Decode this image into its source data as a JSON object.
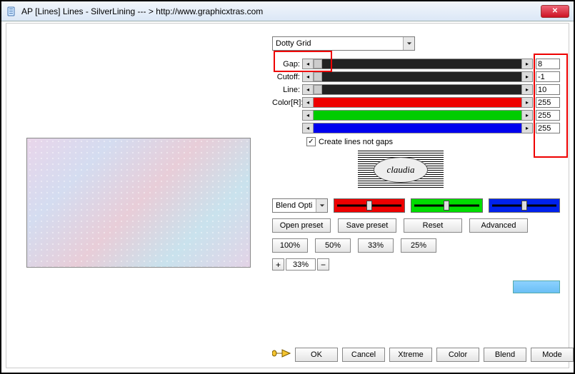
{
  "window": {
    "title": "AP [Lines]  Lines - SilverLining    --- >  http://www.graphicxtras.com"
  },
  "preset_selected": "Dotty Grid",
  "params": {
    "gap": {
      "label": "Gap:",
      "value": "8"
    },
    "cutoff": {
      "label": "Cutoff:",
      "value": "-1"
    },
    "line": {
      "label": "Line:",
      "value": "10"
    },
    "colorR": {
      "label": "Color[R]:",
      "value": "255"
    },
    "colorG": {
      "label": "",
      "value": "255"
    },
    "colorB": {
      "label": "",
      "value": "255"
    }
  },
  "create_lines_label": "Create lines not gaps",
  "create_lines_checked": true,
  "logo_text": "claudia",
  "blend_combo": "Blend Opti",
  "buttons": {
    "open_preset": "Open preset",
    "save_preset": "Save preset",
    "reset": "Reset",
    "advanced": "Advanced",
    "p100": "100%",
    "p50": "50%",
    "p33": "33%",
    "p25": "25%",
    "plus": "+",
    "minus": "−",
    "zoom_value": "33%",
    "ok": "OK",
    "cancel": "Cancel",
    "xtreme": "Xtreme",
    "color": "Color",
    "blend": "Blend",
    "mode": "Mode"
  },
  "close_glyph": "✕"
}
